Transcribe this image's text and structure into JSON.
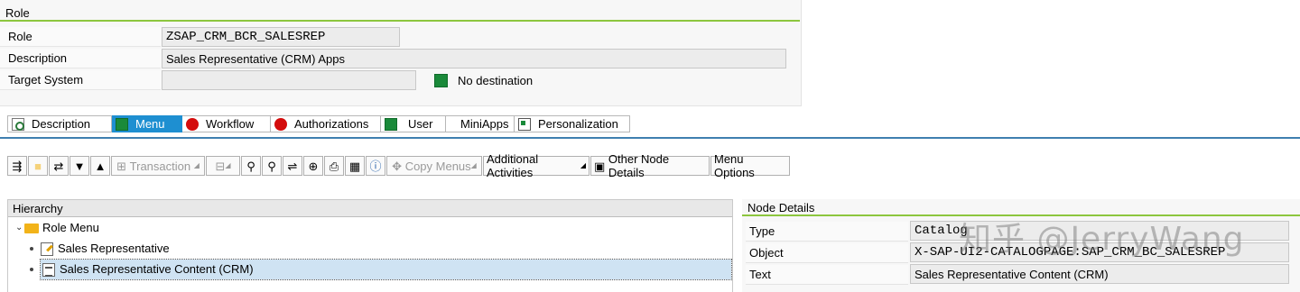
{
  "role_section": {
    "title": "Role",
    "rows": {
      "role": {
        "label": "Role",
        "value": "ZSAP_CRM_BCR_SALESREP"
      },
      "description": {
        "label": "Description",
        "value": "Sales Representative (CRM) Apps"
      },
      "target_system": {
        "label": "Target System",
        "value": "",
        "status_text": "No destination"
      }
    }
  },
  "tabs": [
    {
      "label": "Description",
      "icon": "description-icon"
    },
    {
      "label": "Menu",
      "icon": "green-square-icon",
      "active": true
    },
    {
      "label": "Workflow",
      "icon": "red-circle-icon"
    },
    {
      "label": "Authorizations",
      "icon": "red-circle-icon"
    },
    {
      "label": "User",
      "icon": "green-square-icon"
    },
    {
      "label": "MiniApps",
      "icon": ""
    },
    {
      "label": "Personalization",
      "icon": "personalization-icon"
    }
  ],
  "toolbar": {
    "transaction": "Transaction",
    "copy_menus": "Copy Menus",
    "additional_activities": "Additional Activities",
    "other_node_details": "Other Node Details",
    "menu_options": "Menu Options"
  },
  "hierarchy": {
    "title": "Hierarchy",
    "root": "Role Menu",
    "items": [
      "Sales Representative",
      "Sales Representative Content (CRM)"
    ]
  },
  "node_details": {
    "title": "Node Details",
    "rows": {
      "type": {
        "label": "Type",
        "value": "Catalog"
      },
      "object": {
        "label": "Object",
        "value": "X-SAP-UI2-CATALOGPAGE:SAP_CRM_BC_SALESREP"
      },
      "text": {
        "label": "Text",
        "value": "Sales Representative Content (CRM)"
      }
    }
  },
  "watermark": "知乎 @JerryWang",
  "colors": {
    "accent_green": "#8cc63e",
    "tab_active": "#1e8fd1",
    "status_green": "#1a8a3a",
    "status_red": "#d40c0c",
    "selection": "#cfe3f3"
  }
}
